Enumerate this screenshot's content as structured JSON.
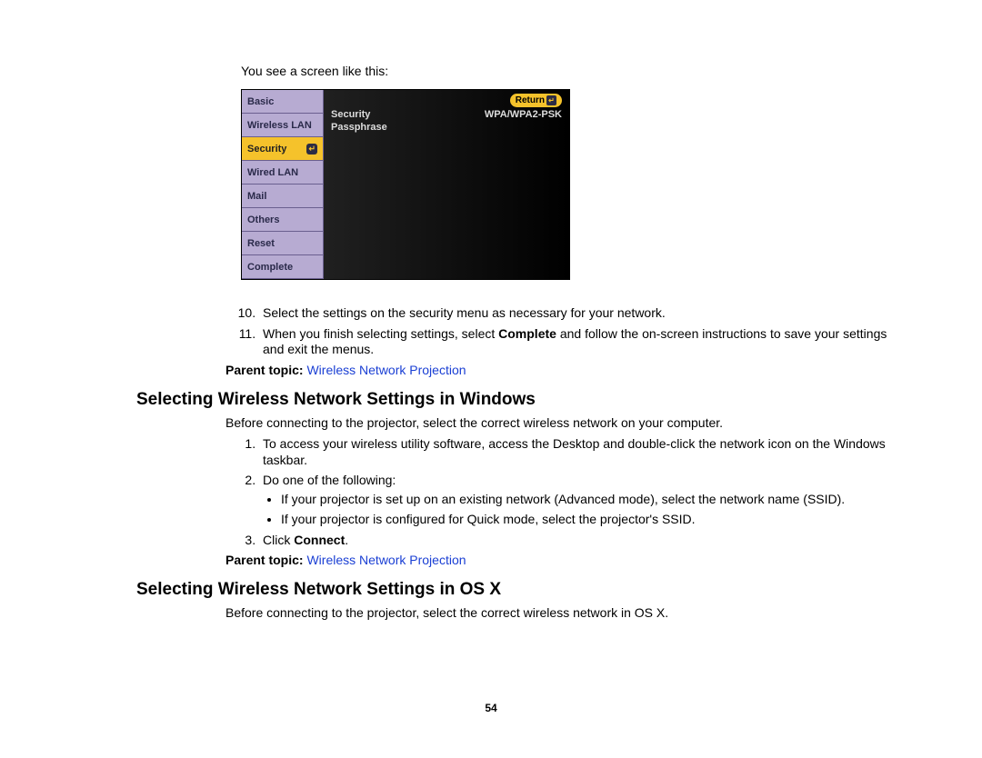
{
  "page_number": "54",
  "intro_text": "You see a screen like this:",
  "menu": {
    "tabs": [
      {
        "label": "Basic"
      },
      {
        "label": "Wireless LAN"
      },
      {
        "label": "Security",
        "selected": true
      },
      {
        "label": "Wired LAN"
      },
      {
        "label": "Mail"
      },
      {
        "label": "Others"
      },
      {
        "label": "Reset"
      },
      {
        "label": "Complete"
      }
    ],
    "return_label": "Return",
    "panel_rows": [
      {
        "label": "Security",
        "value": "WPA/WPA2-PSK"
      },
      {
        "label": "Passphrase",
        "value": ""
      }
    ]
  },
  "steps_a": {
    "start": 10,
    "items": [
      {
        "text": "Select the settings on the security menu as necessary for your network."
      },
      {
        "text_pre": "When you finish selecting settings, select ",
        "bold": "Complete",
        "text_post": " and follow the on-screen instructions to save your settings and exit the menus."
      }
    ]
  },
  "parent_topic": {
    "label": "Parent topic:",
    "link_text": "Wireless Network Projection"
  },
  "section_windows": {
    "heading": "Selecting Wireless Network Settings in Windows",
    "intro": "Before connecting to the projector, select the correct wireless network on your computer.",
    "steps": [
      {
        "text": "To access your wireless utility software, access the Desktop and double-click the network icon on the Windows taskbar."
      },
      {
        "text": "Do one of the following:",
        "bullets": [
          "If your projector is set up on an existing network (Advanced mode), select the network name (SSID).",
          "If your projector is configured for Quick mode, select the projector's SSID."
        ]
      },
      {
        "text_pre": "Click ",
        "bold": "Connect",
        "text_post": "."
      }
    ]
  },
  "section_osx": {
    "heading": "Selecting Wireless Network Settings in OS X",
    "intro": "Before connecting to the projector, select the correct wireless network in OS X."
  }
}
